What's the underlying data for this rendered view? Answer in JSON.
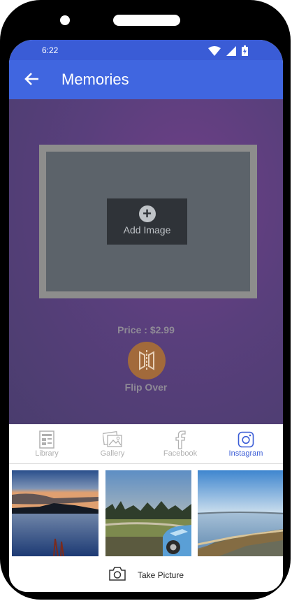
{
  "status": {
    "time": "6:22"
  },
  "appbar": {
    "title": "Memories"
  },
  "editor": {
    "add_image_label": "Add Image",
    "price_text": "Price : $2.99",
    "flip_label": "Flip Over"
  },
  "tabs": [
    {
      "label": "Library",
      "icon": "library-icon",
      "active": false
    },
    {
      "label": "Gallery",
      "icon": "gallery-icon",
      "active": false
    },
    {
      "label": "Facebook",
      "icon": "facebook-icon",
      "active": false
    },
    {
      "label": "Instagram",
      "icon": "instagram-icon",
      "active": true
    }
  ],
  "photos": [
    {
      "subject": "sunset over water"
    },
    {
      "subject": "park with parked car"
    },
    {
      "subject": "bay shoreline"
    }
  ],
  "take_picture": {
    "label": "Take Picture"
  },
  "colors": {
    "status_bar": "#3a5cd6",
    "app_bar": "#4066e0",
    "accent": "#3a5cd6",
    "flip_button": "#a26a3b"
  }
}
